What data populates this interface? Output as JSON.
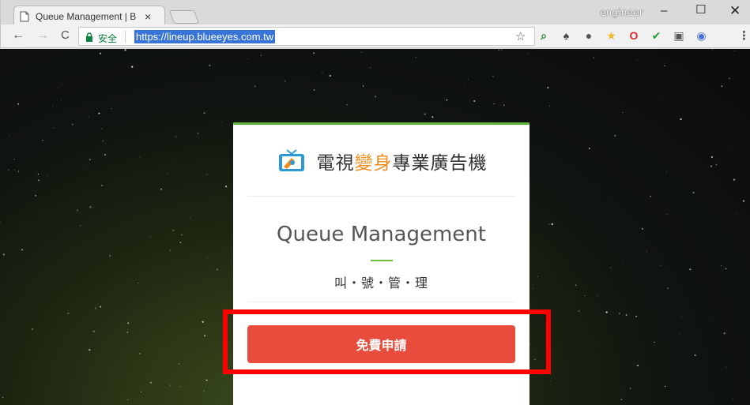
{
  "browser": {
    "tab_title": "Queue Management | B",
    "tab_close": "×",
    "profile_name": "engineer",
    "window_minimize": "–",
    "window_maximize": "☐",
    "window_close": "✕",
    "nav_back": "←",
    "nav_forward": "→",
    "nav_reload": "C",
    "secure_label": "安全",
    "url": "https://lineup.blueeyes.com.tw",
    "bookmark_star": "☆",
    "menu": "⋮",
    "extensions": [
      {
        "name": "ext-1-icon",
        "glyph": "⌕",
        "color": "#2d7d32"
      },
      {
        "name": "ext-2-icon",
        "glyph": "♠",
        "color": "#444444"
      },
      {
        "name": "ext-3-icon",
        "glyph": "●",
        "color": "#555555"
      },
      {
        "name": "ext-4-icon",
        "glyph": "★",
        "color": "#f2b82d"
      },
      {
        "name": "opera-icon",
        "glyph": "O",
        "color": "#e3282d"
      },
      {
        "name": "check-icon",
        "glyph": "✔",
        "color": "#1f9b3b"
      },
      {
        "name": "ext-5-icon",
        "glyph": "▣",
        "color": "#555555"
      },
      {
        "name": "ext-6-icon",
        "glyph": "◉",
        "color": "#4a6fd6"
      }
    ]
  },
  "page": {
    "brand_text_pre": "電視",
    "brand_text_highlight": "變身",
    "brand_text_post": "專業廣告機",
    "title": "Queue Management",
    "subtitle": "叫・號・管・理",
    "apply_button": "免費申請"
  },
  "colors": {
    "accent_green": "#5db33a",
    "button_red": "#e74c3c",
    "highlight_red": "#ff0000",
    "brand_orange": "#f08c1c",
    "url_selection": "#3874d8"
  }
}
